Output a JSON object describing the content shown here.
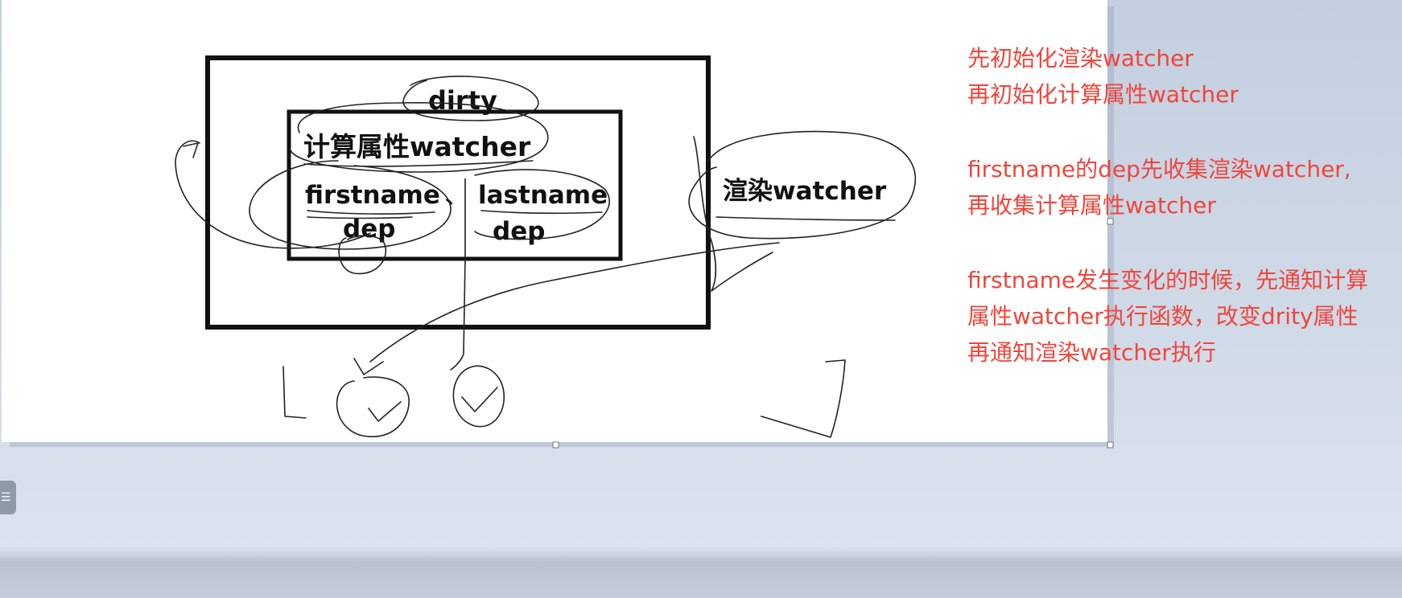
{
  "diagram": {
    "dirty_label": "dirty",
    "computed_watcher_label": "计算属性watcher",
    "firstname_label": "firstname",
    "separator": "、",
    "lastname_label": "lastname",
    "firstname_dep_label": "dep",
    "lastname_dep_label": "dep",
    "render_watcher_label": "渲染watcher"
  },
  "notes": {
    "line1": "先初始化渲染watcher",
    "line2": "再初始化计算属性watcher",
    "line3": "firstname的dep先收集渲染watcher,",
    "line4": "再收集计算属性watcher",
    "line5": "firstname发生变化的时候，先通知计算",
    "line6": "属性watcher执行函数，改变drity属性",
    "line7": "再通知渲染watcher执行"
  },
  "colors": {
    "note_text": "#f0453b",
    "diagram_stroke": "#111111",
    "background": "#d2dbe8"
  },
  "icons": {
    "side_tab": "list-icon"
  }
}
